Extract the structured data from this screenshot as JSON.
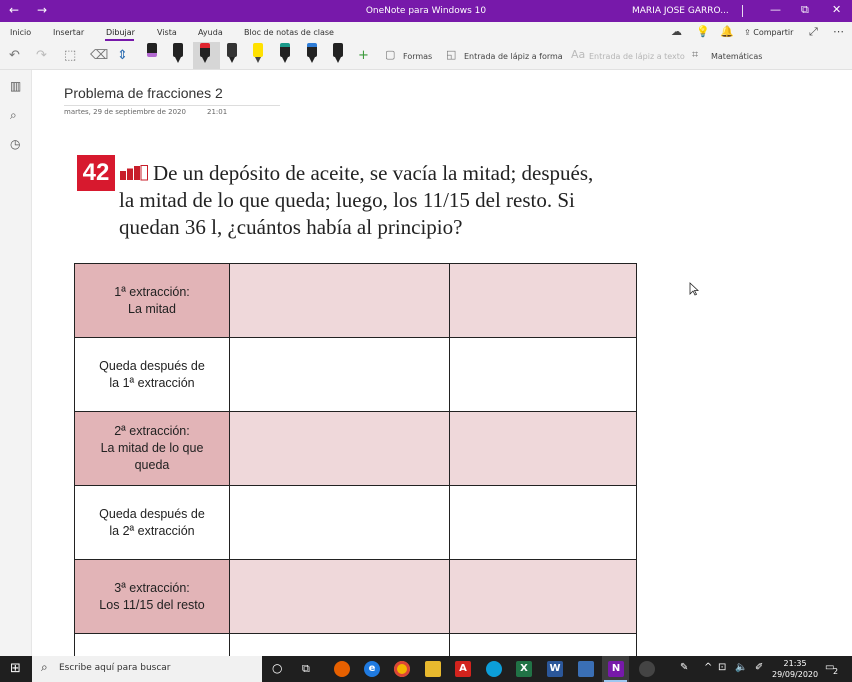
{
  "window": {
    "title": "OneNote para Windows 10",
    "user": "MARIA JOSE GARRO...",
    "back_glyph": "←",
    "forward_glyph": "→",
    "min_glyph": "—",
    "restore_glyph": "⧉",
    "close_glyph": "✕",
    "accent_color": "#7719aa"
  },
  "ribbon": {
    "tabs": [
      "Inicio",
      "Insertar",
      "Dibujar",
      "Vista",
      "Ayuda",
      "Bloc de notas de clase"
    ],
    "active_tab": "Dibujar",
    "share_label": "Compartir",
    "more_glyph": "⋯"
  },
  "toolbar": {
    "shapes_label": "Formas",
    "ink_to_shape_label": "Entrada de lápiz a forma",
    "ink_to_text_label": "Entrada de lápiz a texto",
    "math_label": "Matemáticas",
    "add_glyph": "+"
  },
  "page": {
    "title": "Problema de fracciones 2",
    "date": "martes, 29 de septiembre de 2020",
    "time": "21:01"
  },
  "problem": {
    "number": "42",
    "text": "De un depósito de aceite, se vacía la mitad; después, la mitad de lo que queda; luego, los 11/15 del resto. Si quedan 36 l, ¿cuántos había al principio?"
  },
  "table": {
    "shaded_color": "#e2b4b7",
    "shaded_light_color": "#efd8da",
    "rows": [
      {
        "label": "1ª extracción:\nLa mitad",
        "shaded": true
      },
      {
        "label": "Queda después de\nla 1ª extracción",
        "shaded": false
      },
      {
        "label": "2ª extracción:\nLa mitad de lo que\nqueda",
        "shaded": true
      },
      {
        "label": "Queda después de\nla 2ª extracción",
        "shaded": false
      },
      {
        "label": "3ª extracción:\nLos 11/15 del resto",
        "shaded": true
      },
      {
        "label": "",
        "shaded": false
      }
    ]
  },
  "taskbar": {
    "search_placeholder": "Escribe aquí para buscar",
    "time": "21:35",
    "date": "29/09/2020",
    "notifications": "2"
  }
}
